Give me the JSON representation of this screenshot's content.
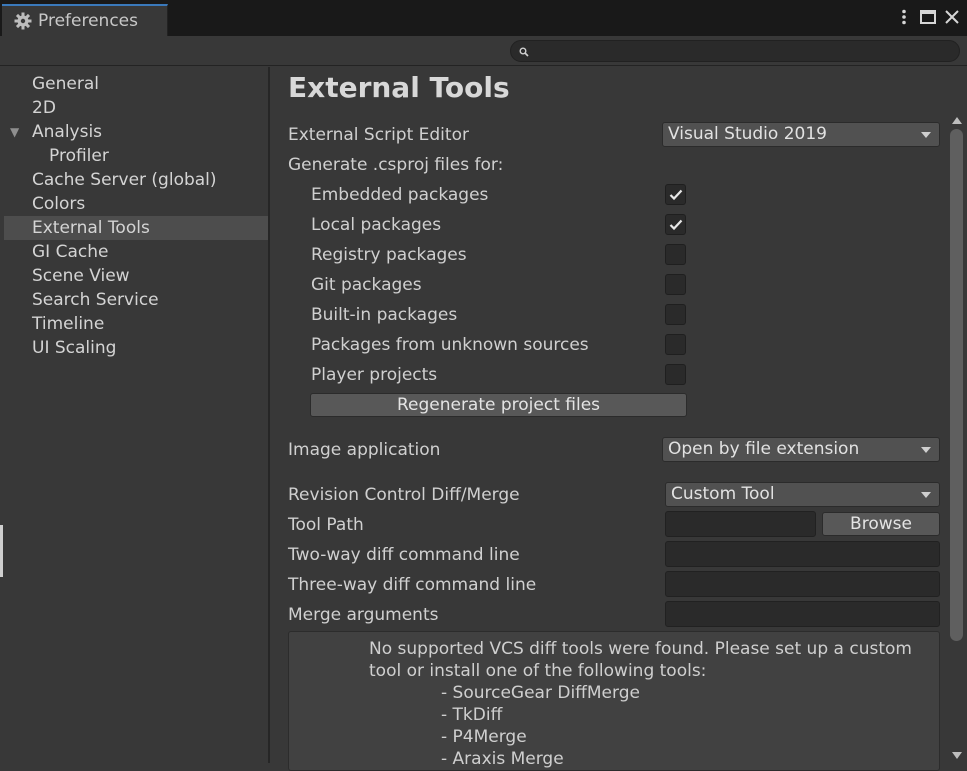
{
  "window": {
    "tab_title": "Preferences",
    "tab_icon": "gear-icon",
    "menu_icon": "kebab-menu-icon",
    "maximize_icon": "maximize-icon",
    "close_icon": "close-icon"
  },
  "search": {
    "placeholder": "",
    "value": ""
  },
  "sidebar": {
    "items": [
      {
        "label": "General",
        "selected": false
      },
      {
        "label": "2D",
        "selected": false
      },
      {
        "label": "Analysis",
        "selected": false,
        "expanded": true
      },
      {
        "label": "Profiler",
        "selected": false,
        "child": true
      },
      {
        "label": "Cache Server (global)",
        "selected": false
      },
      {
        "label": "Colors",
        "selected": false
      },
      {
        "label": "External Tools",
        "selected": true
      },
      {
        "label": "GI Cache",
        "selected": false
      },
      {
        "label": "Scene View",
        "selected": false
      },
      {
        "label": "Search Service",
        "selected": false
      },
      {
        "label": "Timeline",
        "selected": false
      },
      {
        "label": "UI Scaling",
        "selected": false
      }
    ]
  },
  "main": {
    "title": "External Tools",
    "script_editor": {
      "label": "External Script Editor",
      "value": "Visual Studio 2019"
    },
    "csproj_heading": "Generate .csproj files for:",
    "csproj_options": [
      {
        "label": "Embedded packages",
        "checked": true
      },
      {
        "label": "Local packages",
        "checked": true
      },
      {
        "label": "Registry packages",
        "checked": false
      },
      {
        "label": "Git packages",
        "checked": false
      },
      {
        "label": "Built-in packages",
        "checked": false
      },
      {
        "label": "Packages from unknown sources",
        "checked": false
      },
      {
        "label": "Player projects",
        "checked": false
      }
    ],
    "regenerate_button": "Regenerate project files",
    "image_application": {
      "label": "Image application",
      "value": "Open by file extension"
    },
    "revision_control": {
      "label": "Revision Control Diff/Merge",
      "value": "Custom Tool"
    },
    "tool_path": {
      "label": "Tool Path",
      "value": "",
      "browse_label": "Browse"
    },
    "two_way": {
      "label": "Two-way diff command line",
      "value": ""
    },
    "three_way": {
      "label": "Three-way diff command line",
      "value": ""
    },
    "merge_args": {
      "label": "Merge arguments",
      "value": ""
    },
    "help": {
      "message_line1": "No supported VCS diff tools were found. Please set up a custom",
      "message_line2": "tool or install one of the following tools:",
      "tools": [
        "- SourceGear DiffMerge",
        "- TkDiff",
        "- P4Merge",
        "- Araxis Merge"
      ]
    }
  },
  "colors": {
    "background": "#383838",
    "tab_bar": "#191919",
    "accent": "#3a79bb",
    "selected_item": "#4d4d4d"
  }
}
